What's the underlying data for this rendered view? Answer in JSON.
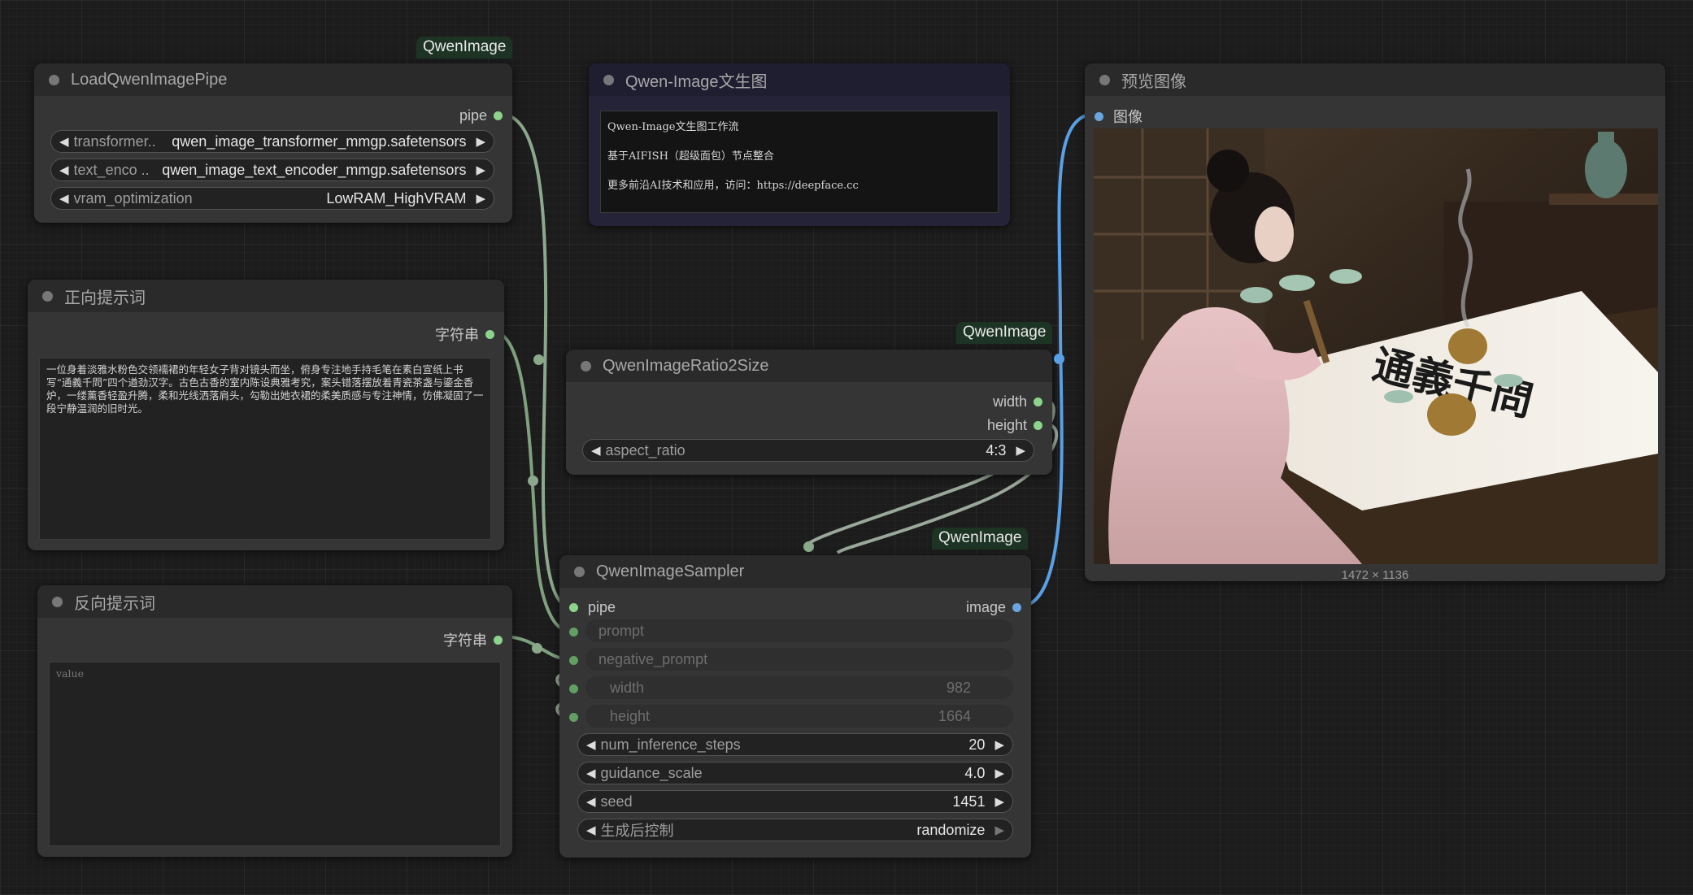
{
  "colors": {
    "canvas": "#1c1c1c",
    "node_body": "#353535",
    "node_title": "#2a2a2a",
    "link_pipe": "#8ca88c",
    "link_string": "#7fa07f",
    "link_image": "#5aa0e6",
    "link_int": "#9aa89a",
    "note_body": "#252338"
  },
  "nodes": {
    "load_pipe": {
      "badge": "QwenImage",
      "title": "LoadQwenImagePipe",
      "output_label": "pipe",
      "widgets": [
        {
          "label": "transformer...",
          "value": "qwen_image_transformer_mmgp.safetensors"
        },
        {
          "label": "text_enco ...",
          "value": "qwen_image_text_encoder_mmgp.safetensors"
        },
        {
          "label": "vram_optimization",
          "value": "LowRAM_HighVRAM"
        }
      ]
    },
    "note": {
      "title": "Qwen-Image文生图",
      "lines": [
        "Qwen-Image文生图工作流",
        "基于AIFISH（超级面包）节点整合",
        "更多前沿AI技术和应用，访问：https://deepface.cc"
      ]
    },
    "preview": {
      "title": "预览图像",
      "input_label": "图像",
      "image_alt": "A woman in a pale pink hanfu dress writing calligraphy on rice paper at a wooden desk with teacups and a brass incense burner",
      "calligraphy": "通義千問",
      "image_size": "1472 × 1136"
    },
    "positive": {
      "title": "正向提示词",
      "output_label": "字符串",
      "text": "一位身着淡雅水粉色交领襦裙的年轻女子背对镜头而坐，俯身专注地手持毛笔在素白宣纸上书写“通義千問”四个遒劲汉字。古色古香的室内陈设典雅考究，案头错落摆放着青瓷茶盏与鎏金香炉，一缕薰香轻盈升腾，柔和光线洒落肩头，勾勒出她衣裙的柔美质感与专注神情，仿佛凝固了一段宁静温润的旧时光。"
    },
    "ratio": {
      "badge": "QwenImage",
      "title": "QwenImageRatio2Size",
      "outputs": [
        "width",
        "height"
      ],
      "widget": {
        "label": "aspect_ratio",
        "value": "4:3"
      }
    },
    "negative": {
      "title": "反向提示词",
      "output_label": "字符串",
      "placeholder": "value"
    },
    "sampler": {
      "badge": "QwenImage",
      "title": "QwenImageSampler",
      "output_label": "image",
      "inputs": [
        {
          "label": "pipe"
        },
        {
          "label": "prompt"
        },
        {
          "label": "negative_prompt"
        },
        {
          "label": "width",
          "value": "982"
        },
        {
          "label": "height",
          "value": "1664"
        }
      ],
      "widgets": [
        {
          "label": "num_inference_steps",
          "value": "20"
        },
        {
          "label": "guidance_scale",
          "value": "4.0"
        },
        {
          "label": "seed",
          "value": "1451"
        },
        {
          "label": "生成后控制",
          "value": "randomize"
        }
      ]
    }
  }
}
